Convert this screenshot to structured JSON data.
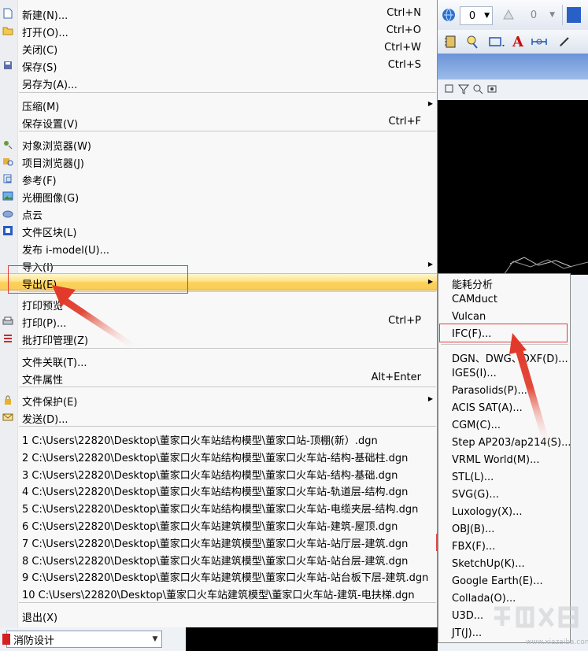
{
  "file_menu": {
    "items": [
      {
        "label": "新建(N)...",
        "shortcut": "Ctrl+N",
        "icon": "new-file-icon"
      },
      {
        "label": "打开(O)...",
        "shortcut": "Ctrl+O",
        "icon": "open-folder-icon"
      },
      {
        "label": "关闭(C)",
        "shortcut": "Ctrl+W",
        "icon": ""
      },
      {
        "label": "保存(S)",
        "shortcut": "Ctrl+S",
        "icon": "save-icon"
      },
      {
        "label": "另存为(A)...",
        "shortcut": "",
        "icon": ""
      },
      {
        "label": "压缩(M)",
        "shortcut": "",
        "icon": "",
        "submenu": true
      },
      {
        "label": "保存设置(V)",
        "shortcut": "Ctrl+F",
        "icon": ""
      },
      {
        "label": "对象浏览器(W)",
        "shortcut": "",
        "icon": "object-browser-icon"
      },
      {
        "label": "项目浏览器(J)",
        "shortcut": "",
        "icon": "project-browser-icon"
      },
      {
        "label": "参考(F)",
        "shortcut": "",
        "icon": "reference-icon"
      },
      {
        "label": "光栅图像(G)",
        "shortcut": "",
        "icon": "raster-image-icon"
      },
      {
        "label": "点云",
        "shortcut": "",
        "icon": "point-cloud-icon"
      },
      {
        "label": "文件区块(L)",
        "shortcut": "",
        "icon": "file-block-icon"
      },
      {
        "label": "发布 i-model(U)...",
        "shortcut": "",
        "icon": ""
      },
      {
        "label": "导入(I)",
        "shortcut": "",
        "icon": "",
        "submenu": true
      },
      {
        "label": "导出(E)",
        "shortcut": "",
        "icon": "",
        "submenu": true,
        "highlighted": true
      },
      {
        "label": "打印预览",
        "shortcut": "",
        "icon": ""
      },
      {
        "label": "打印(P)...",
        "shortcut": "Ctrl+P",
        "icon": "printer-icon"
      },
      {
        "label": "批打印管理(Z)",
        "shortcut": "",
        "icon": "batch-print-icon"
      },
      {
        "label": "文件关联(T)...",
        "shortcut": "",
        "icon": ""
      },
      {
        "label": "文件属性",
        "shortcut": "Alt+Enter",
        "icon": ""
      },
      {
        "label": "文件保护(E)",
        "shortcut": "",
        "icon": "lock-icon",
        "submenu": true
      },
      {
        "label": "发送(D)...",
        "shortcut": "",
        "icon": "send-icon"
      }
    ],
    "recent_files": [
      "1 C:\\Users\\22820\\Desktop\\董家口火车站结构模型\\董家口站-顶棚(新）.dgn",
      "2 C:\\Users\\22820\\Desktop\\董家口火车站结构模型\\董家口火车站-结构-基础柱.dgn",
      "3 C:\\Users\\22820\\Desktop\\董家口火车站结构模型\\董家口火车站-结构-基础.dgn",
      "4 C:\\Users\\22820\\Desktop\\董家口火车站结构模型\\董家口火车站-轨道层-结构.dgn",
      "5 C:\\Users\\22820\\Desktop\\董家口火车站结构模型\\董家口火车站-电缆夹层-结构.dgn",
      "6 C:\\Users\\22820\\Desktop\\董家口火车站建筑模型\\董家口火车站-建筑-屋顶.dgn",
      "7 C:\\Users\\22820\\Desktop\\董家口火车站建筑模型\\董家口火车站-站厅层-建筑.dgn",
      "8 C:\\Users\\22820\\Desktop\\董家口火车站建筑模型\\董家口火车站-站台层-建筑.dgn",
      "9 C:\\Users\\22820\\Desktop\\董家口火车站建筑模型\\董家口火车站-站台板下层-建筑.dgn",
      "10 C:\\Users\\22820\\Desktop\\董家口火车站建筑模型\\董家口火车站-建筑-电扶梯.dgn"
    ],
    "exit_label": "退出(X)"
  },
  "export_submenu": {
    "items": [
      "能耗分析",
      "CAMduct",
      "Vulcan",
      "IFC(F)...",
      "DGN、DWG、DXF(D)...",
      "IGES(I)...",
      "Parasolids(P)...",
      "ACIS SAT(A)...",
      "CGM(C)...",
      "Step AP203/ap214(S)...",
      "VRML World(M)...",
      "STL(L)...",
      "SVG(G)...",
      "Luxology(X)...",
      "OBJ(B)...",
      "FBX(F)...",
      "SketchUp(K)...",
      "Google Earth(E)...",
      "Collada(O)...",
      "U3D...",
      "JT(J)..."
    ]
  },
  "toolbar": {
    "level_value": "0",
    "level_value2": "0"
  },
  "bottom_bar": {
    "combo_value": "消防设计"
  },
  "annotations": {
    "highlight_color": "#e23a3a"
  },
  "watermark_text": "www.xiazaiba.com"
}
